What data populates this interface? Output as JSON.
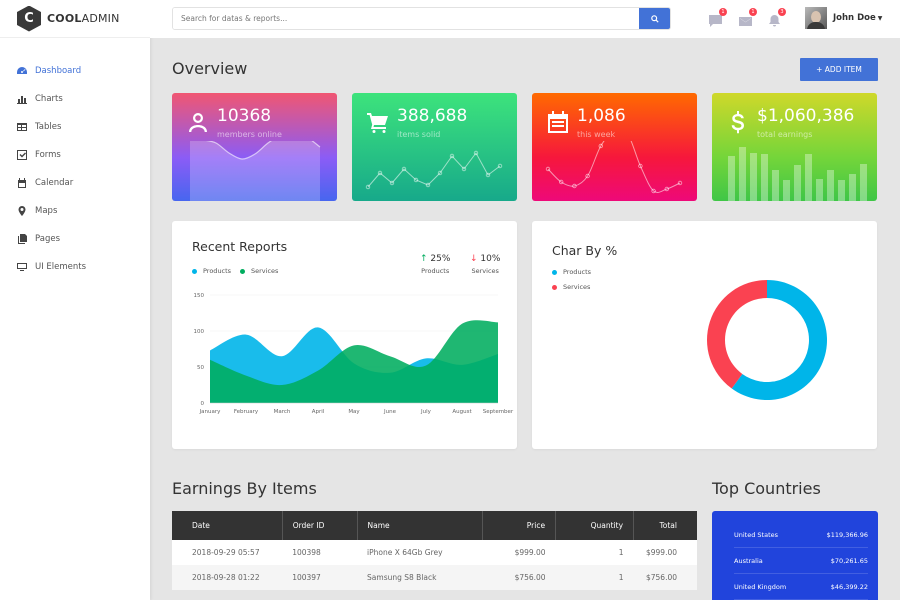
{
  "brand": {
    "logo_letter": "C",
    "name_bold": "COOL",
    "name_light": "ADMIN"
  },
  "sidebar": {
    "items": [
      {
        "label": "Dashboard",
        "icon": "dashboard-icon",
        "active": true
      },
      {
        "label": "Charts",
        "icon": "bar-chart-icon"
      },
      {
        "label": "Tables",
        "icon": "table-icon"
      },
      {
        "label": "Forms",
        "icon": "check-square-icon"
      },
      {
        "label": "Calendar",
        "icon": "calendar-icon"
      },
      {
        "label": "Maps",
        "icon": "map-marker-icon"
      },
      {
        "label": "Pages",
        "icon": "copy-icon"
      },
      {
        "label": "UI Elements",
        "icon": "desktop-icon"
      }
    ]
  },
  "header": {
    "search_placeholder": "Search for datas & reports...",
    "notifications": [
      {
        "icon": "comment-icon",
        "count": "1"
      },
      {
        "icon": "email-icon",
        "count": "1"
      },
      {
        "icon": "bell-icon",
        "count": "3"
      }
    ],
    "user_name": "John Doe"
  },
  "overview": {
    "title": "Overview",
    "add_button": "+ ADD ITEM",
    "stats": [
      {
        "value": "10368",
        "label": "members online",
        "icon": "user-icon",
        "spark_series": [
          62,
          61,
          58,
          48,
          42,
          47,
          58,
          66,
          71,
          64,
          54
        ]
      },
      {
        "value": "388,688",
        "label": "items solid",
        "icon": "cart-icon",
        "spark_series": [
          14,
          28,
          18,
          32,
          21,
          16,
          28,
          45,
          32,
          48,
          26,
          35
        ]
      },
      {
        "value": "1,086",
        "label": "this week",
        "icon": "calendar-icon",
        "spark_series": [
          32,
          19,
          15,
          25,
          55,
          70,
          68,
          35,
          10,
          12,
          18
        ]
      },
      {
        "value": "$1,060,386",
        "label": "total earnings",
        "icon": "dollar-icon",
        "spark_series": [
          45,
          54,
          48,
          47,
          31,
          21,
          36,
          47,
          22,
          31,
          21,
          27,
          37
        ]
      }
    ]
  },
  "recent_reports": {
    "title": "Recent Reports",
    "legend": [
      {
        "label": "Products",
        "color": "#00b5e9"
      },
      {
        "label": "Services",
        "color": "#00ad5f"
      }
    ],
    "stats": [
      {
        "value": "25%",
        "label": "Products",
        "direction": "up"
      },
      {
        "value": "10%",
        "label": "Services",
        "direction": "down"
      }
    ]
  },
  "char_by_pct": {
    "title": "Char By %",
    "legend": [
      {
        "label": "Products",
        "color": "#00b5e9"
      },
      {
        "label": "Services",
        "color": "#fa4251"
      }
    ]
  },
  "chart_data": [
    {
      "type": "area",
      "title": "Recent Reports",
      "x": [
        "January",
        "February",
        "March",
        "April",
        "May",
        "June",
        "July",
        "August",
        "September"
      ],
      "y_ticks": [
        "0",
        "50",
        "100",
        "150"
      ],
      "ylim": [
        0,
        150
      ],
      "series": [
        {
          "name": "Products",
          "color": "#00b5e9",
          "values": [
            73,
            95,
            65,
            105,
            55,
            42,
            62,
            53,
            68
          ]
        },
        {
          "name": "Services",
          "color": "#00ad5f",
          "values": [
            60,
            38,
            25,
            45,
            80,
            65,
            52,
            110,
            112
          ]
        }
      ],
      "legend": "top-left",
      "grid": true
    },
    {
      "type": "pie",
      "title": "Char By %",
      "labels": [
        "Products",
        "Services"
      ],
      "values": [
        60,
        40
      ],
      "colors": [
        "#00b5e9",
        "#fa4251"
      ],
      "donut": true
    }
  ],
  "earnings": {
    "title": "Earnings By Items",
    "columns": [
      "Date",
      "Order ID",
      "Name",
      "Price",
      "Quantity",
      "Total"
    ],
    "rows": [
      [
        "2018-09-29 05:57",
        "100398",
        "iPhone X 64Gb Grey",
        "$999.00",
        "1",
        "$999.00"
      ],
      [
        "2018-09-28 01:22",
        "100397",
        "Samsung S8 Black",
        "$756.00",
        "1",
        "$756.00"
      ]
    ]
  },
  "top_countries": {
    "title": "Top Countries",
    "rows": [
      {
        "country": "United States",
        "amount": "$119,366.96"
      },
      {
        "country": "Australia",
        "amount": "$70,261.65"
      },
      {
        "country": "United Kingdom",
        "amount": "$46,399.22"
      }
    ]
  }
}
